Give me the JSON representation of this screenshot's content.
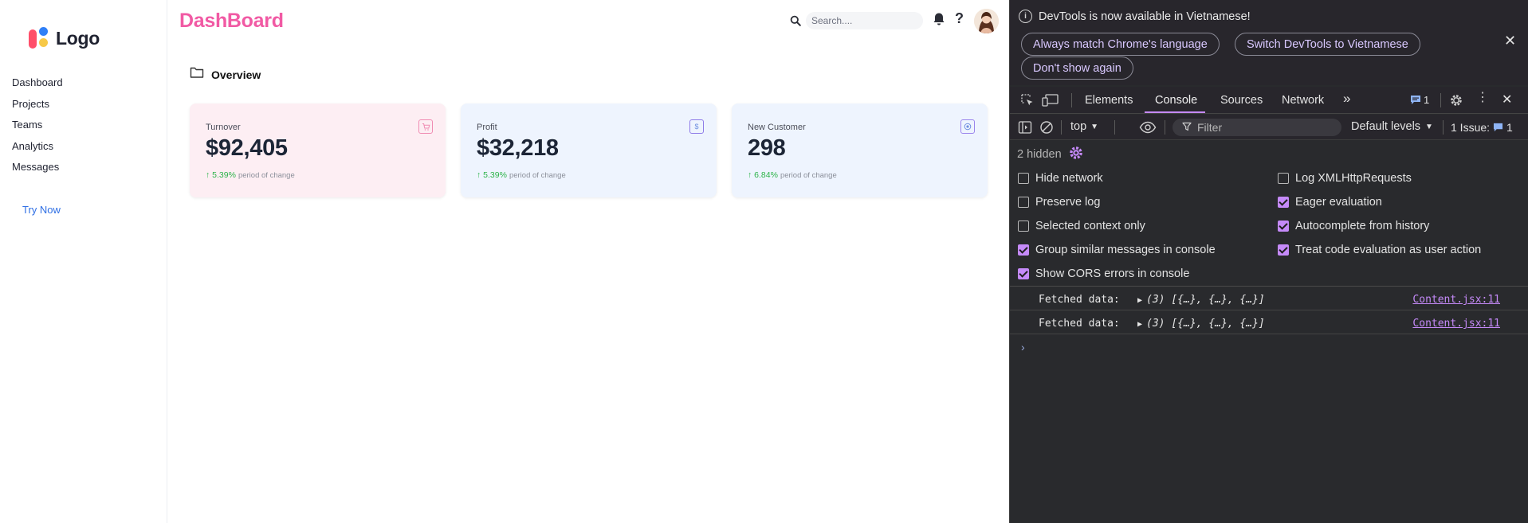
{
  "app": {
    "logo_text": "Logo",
    "brand": "DashBoard",
    "nav": [
      "Dashboard",
      "Projects",
      "Teams",
      "Analytics",
      "Messages"
    ],
    "try_now": "Try Now",
    "search_placeholder": "Search....",
    "help_label": "?",
    "section_title": "Overview",
    "cards": [
      {
        "label": "Turnover",
        "value": "$92,405",
        "change": "↑ 5.39%",
        "period": "period of change",
        "icon": "cart-icon",
        "bg": "#fdeef3",
        "accent": "#f08bb2"
      },
      {
        "label": "Profit",
        "value": "$32,218",
        "change": "↑ 5.39%",
        "period": "period of change",
        "icon": "dollar-icon",
        "bg": "#eef4fe",
        "accent": "#6f8fe0"
      },
      {
        "label": "New Customer",
        "value": "298",
        "change": "↑ 6.84%",
        "period": "period of change",
        "icon": "customer-icon",
        "bg": "#eef4fe",
        "accent": "#9a84ec"
      }
    ]
  },
  "devtools": {
    "info_message": "DevTools is now available in Vietnamese!",
    "btn_match": "Always match Chrome's language",
    "btn_switch": "Switch DevTools to Vietnamese",
    "btn_dont_show": "Don't show again",
    "tabs": [
      "Elements",
      "Console",
      "Sources",
      "Network"
    ],
    "active_tab": "Console",
    "issues_badge": "1",
    "context": "top",
    "filter_placeholder": "Filter",
    "levels": "Default levels",
    "issue_count": "1 Issue:",
    "issue_badge": "1",
    "hidden_count": "2 hidden",
    "settings_left": [
      {
        "label": "Hide network",
        "checked": false
      },
      {
        "label": "Preserve log",
        "checked": false
      },
      {
        "label": "Selected context only",
        "checked": false
      },
      {
        "label": "Group similar messages in console",
        "checked": true
      },
      {
        "label": "Show CORS errors in console",
        "checked": true
      }
    ],
    "settings_right": [
      {
        "label": "Log XMLHttpRequests",
        "checked": false
      },
      {
        "label": "Eager evaluation",
        "checked": true
      },
      {
        "label": "Autocomplete from history",
        "checked": true
      },
      {
        "label": "Treat code evaluation as user action",
        "checked": true
      }
    ],
    "logs": [
      {
        "message": "Fetched data:",
        "object": "(3) [{…}, {…}, {…}]",
        "source": "Content.jsx:11"
      },
      {
        "message": "Fetched data:",
        "object": "(3) [{…}, {…}, {…}]",
        "source": "Content.jsx:11"
      }
    ],
    "prompt_symbol": "›"
  }
}
